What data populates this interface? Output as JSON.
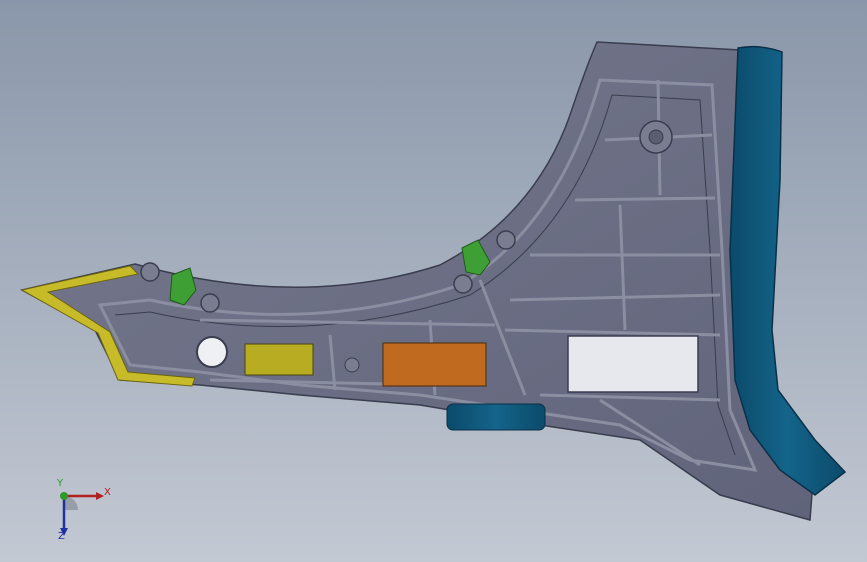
{
  "viewport": {
    "background_top": "#8a97aa",
    "background_bottom": "#c3c9d3"
  },
  "model": {
    "part_color": "#6e7184",
    "edge_color": "#3a3d4e",
    "rib_color": "#8b8ea0",
    "flange_color": "#0e5577",
    "yellow_face_color": "#c8bb2a",
    "olive_pad_color": "#b8ad22",
    "orange_pad_color": "#c06a20",
    "clip_color": "#3ea034",
    "cutout_color": "#e6e8ee"
  },
  "triad": {
    "x_label": "X",
    "y_label": "Y",
    "z_label": "Z",
    "x_color": "#b02020",
    "y_color": "#2a9a2a",
    "z_color": "#2030a0",
    "icon": "coordinate-triad-icon"
  }
}
